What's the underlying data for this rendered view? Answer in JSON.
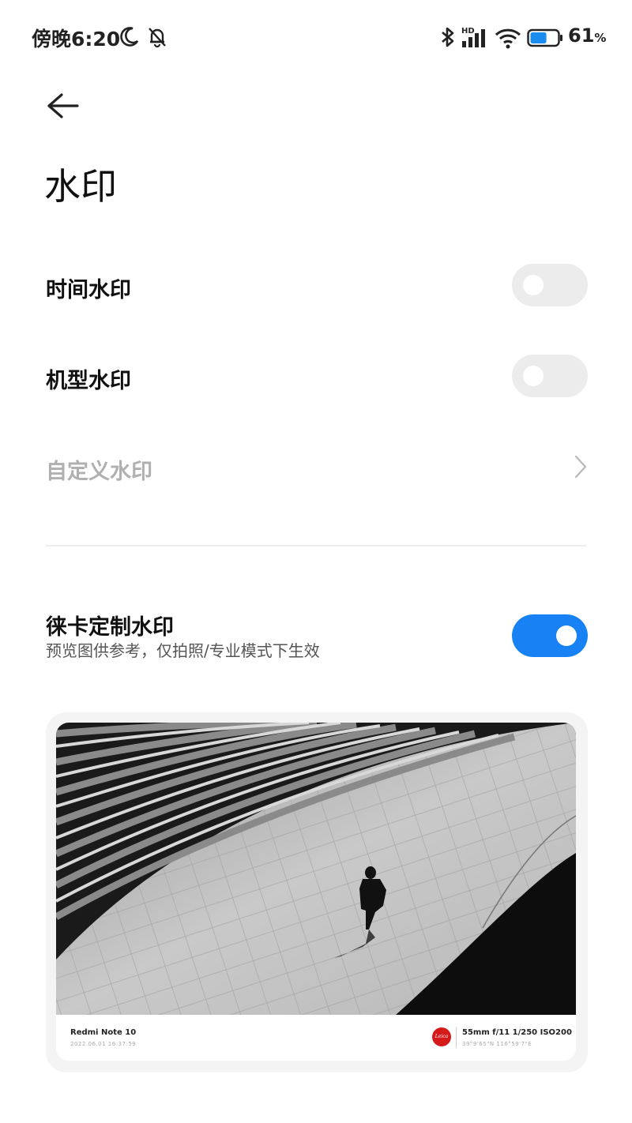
{
  "status_bar": {
    "time": "傍晚6:20",
    "network_badge": "HD",
    "battery_percent": "61",
    "battery_unit": "%",
    "battery_level": 0.61,
    "icons": [
      "moon-icon",
      "bell-off-icon",
      "bluetooth-icon",
      "signal-icon",
      "wifi-icon",
      "battery-icon"
    ]
  },
  "page": {
    "title": "水印"
  },
  "settings": {
    "time_watermark": {
      "label": "时间水印",
      "enabled": false
    },
    "model_watermark": {
      "label": "机型水印",
      "enabled": false
    },
    "custom_watermark": {
      "label": "自定义水印"
    },
    "leica_watermark": {
      "label": "徕卡定制水印",
      "subtitle": "预览图供参考，仅拍照/专业模式下生效",
      "enabled": true
    }
  },
  "preview": {
    "model": "Redmi Note 10",
    "datetime": "2022.06.01 16:37:59",
    "logo_text": "Leica",
    "params": "55mm  f/11  1/250  ISO200",
    "gps": "39°9'65\"N  116°59'7\"E"
  },
  "colors": {
    "accent": "#1882f5",
    "toggle_off": "#ececec",
    "disabled_text": "#b0b0b0",
    "leica_red": "#d51a1a"
  }
}
